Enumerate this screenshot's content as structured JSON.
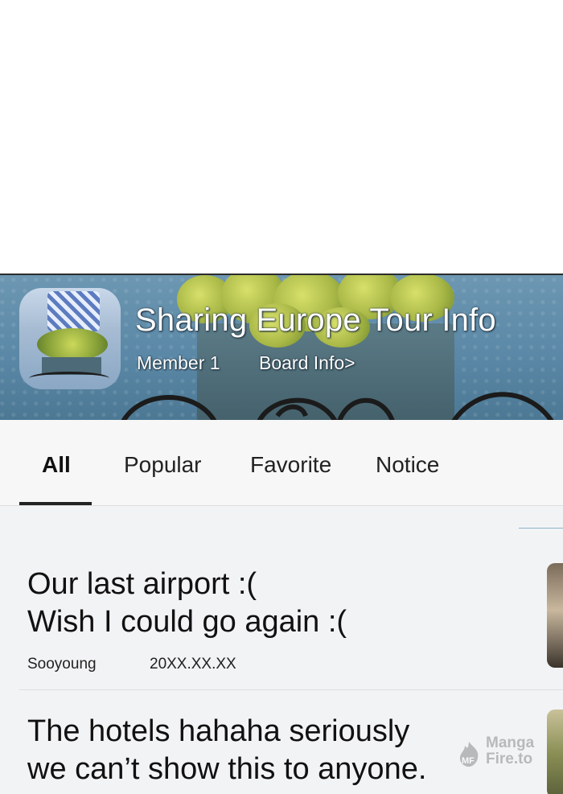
{
  "board": {
    "title": "Sharing Europe Tour Info",
    "members": "Member 1",
    "board_info": "Board Info>"
  },
  "tabs": [
    {
      "label": "All",
      "active": true
    },
    {
      "label": "Popular",
      "active": false
    },
    {
      "label": "Favorite",
      "active": false
    },
    {
      "label": "Notice",
      "active": false
    }
  ],
  "posts": [
    {
      "title_lines": [
        "Our last airport :(",
        "Wish I could go again :("
      ],
      "author": "Sooyoung",
      "date": "20XX.XX.XX"
    },
    {
      "title_lines": [
        "The hotels hahaha seriously",
        "we can’t show this to anyone."
      ]
    }
  ],
  "watermark": {
    "line1": "Manga",
    "line2": "Fire.to"
  },
  "icons": [
    "flame-logo-icon"
  ]
}
